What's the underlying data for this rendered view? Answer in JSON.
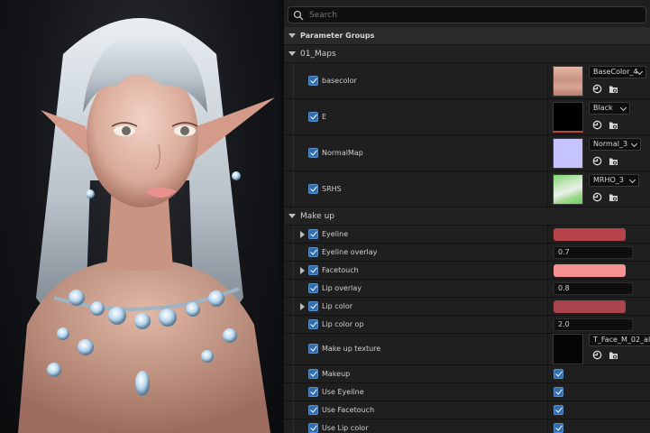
{
  "search": {
    "placeholder": "Search"
  },
  "header": {
    "title": "Parameter Groups"
  },
  "groups": {
    "maps": {
      "label": "01_Maps",
      "params": [
        {
          "name": "basecolor",
          "texture": "BaseColor_4"
        },
        {
          "name": "E",
          "texture": "Black"
        },
        {
          "name": "NormalMap",
          "texture": "Normal_3"
        },
        {
          "name": "SRHS",
          "texture": "MRHO_3"
        }
      ]
    },
    "makeup": {
      "label": "Make up",
      "params": {
        "eyeline": {
          "name": "Eyeline",
          "color": "#b5434a"
        },
        "eyeline_overlay": {
          "name": "Eyeline overlay",
          "value": "0.7"
        },
        "facetouch": {
          "name": "Facetouch",
          "color": "#f49191"
        },
        "lip_overlay": {
          "name": "Lip  overlay",
          "value": "0.8"
        },
        "lip_color": {
          "name": "Lip color",
          "color": "#a8444a"
        },
        "lip_color_op": {
          "name": "Lip color op",
          "value": "2.0"
        },
        "makeup_texture": {
          "name": "Make up texture",
          "texture": "T_Face_M_02_alb"
        },
        "makeup": {
          "name": "Makeup"
        },
        "use_eyeline": {
          "name": "Use Eyeline"
        },
        "use_facetouch": {
          "name": "Use Facetouch"
        },
        "use_lip_color": {
          "name": "Use Lip color"
        }
      }
    }
  },
  "colors": {
    "panel_bg": "#1f1f1f",
    "checkbox": "#2f6fb1",
    "viewport_bg": "#14161a"
  },
  "icons": [
    "search-icon",
    "reset-arrow-icon",
    "browse-folder-icon",
    "chevron-down-icon",
    "chevron-right-icon"
  ]
}
